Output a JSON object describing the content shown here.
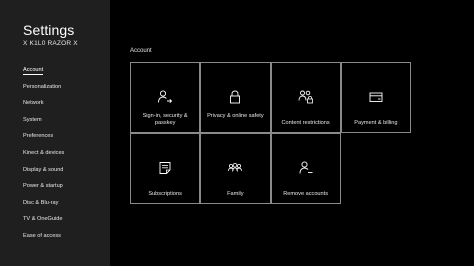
{
  "header": {
    "title": "Settings",
    "subtitle": "X K1L0 RAZOR X"
  },
  "sidebar": {
    "items": [
      {
        "label": "Account",
        "active": true
      },
      {
        "label": "Personalization"
      },
      {
        "label": "Network"
      },
      {
        "label": "System"
      },
      {
        "label": "Preferences"
      },
      {
        "label": "Kinect & devices"
      },
      {
        "label": "Display & sound"
      },
      {
        "label": "Power & startup"
      },
      {
        "label": "Disc & Blu-ray"
      },
      {
        "label": "TV & OneGuide"
      },
      {
        "label": "Ease of access"
      }
    ]
  },
  "main": {
    "section_label": "Account",
    "tiles": [
      {
        "label": "Sign-in, security & passkey",
        "icon": "person-sign-in-icon"
      },
      {
        "label": "Privacy & online safety",
        "icon": "lock-icon"
      },
      {
        "label": "Content restrictions",
        "icon": "family-lock-icon"
      },
      {
        "label": "Payment & billing",
        "icon": "credit-card-icon"
      },
      {
        "label": "Subscriptions",
        "icon": "document-edit-icon"
      },
      {
        "label": "Family",
        "icon": "people-icon"
      },
      {
        "label": "Remove accounts",
        "icon": "person-remove-icon"
      }
    ]
  },
  "colors": {
    "background": "#000000",
    "sidebar": "#1f1f1f",
    "tile_border": "#8a8a8a",
    "text": "#ffffff"
  }
}
